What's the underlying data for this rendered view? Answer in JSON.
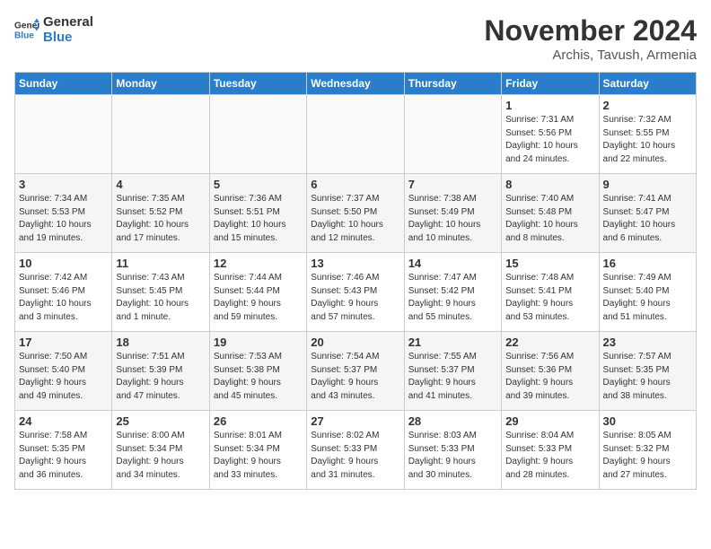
{
  "logo": {
    "line1": "General",
    "line2": "Blue"
  },
  "title": "November 2024",
  "location": "Archis, Tavush, Armenia",
  "weekdays": [
    "Sunday",
    "Monday",
    "Tuesday",
    "Wednesday",
    "Thursday",
    "Friday",
    "Saturday"
  ],
  "weeks": [
    [
      {
        "day": "",
        "info": ""
      },
      {
        "day": "",
        "info": ""
      },
      {
        "day": "",
        "info": ""
      },
      {
        "day": "",
        "info": ""
      },
      {
        "day": "",
        "info": ""
      },
      {
        "day": "1",
        "info": "Sunrise: 7:31 AM\nSunset: 5:56 PM\nDaylight: 10 hours\nand 24 minutes."
      },
      {
        "day": "2",
        "info": "Sunrise: 7:32 AM\nSunset: 5:55 PM\nDaylight: 10 hours\nand 22 minutes."
      }
    ],
    [
      {
        "day": "3",
        "info": "Sunrise: 7:34 AM\nSunset: 5:53 PM\nDaylight: 10 hours\nand 19 minutes."
      },
      {
        "day": "4",
        "info": "Sunrise: 7:35 AM\nSunset: 5:52 PM\nDaylight: 10 hours\nand 17 minutes."
      },
      {
        "day": "5",
        "info": "Sunrise: 7:36 AM\nSunset: 5:51 PM\nDaylight: 10 hours\nand 15 minutes."
      },
      {
        "day": "6",
        "info": "Sunrise: 7:37 AM\nSunset: 5:50 PM\nDaylight: 10 hours\nand 12 minutes."
      },
      {
        "day": "7",
        "info": "Sunrise: 7:38 AM\nSunset: 5:49 PM\nDaylight: 10 hours\nand 10 minutes."
      },
      {
        "day": "8",
        "info": "Sunrise: 7:40 AM\nSunset: 5:48 PM\nDaylight: 10 hours\nand 8 minutes."
      },
      {
        "day": "9",
        "info": "Sunrise: 7:41 AM\nSunset: 5:47 PM\nDaylight: 10 hours\nand 6 minutes."
      }
    ],
    [
      {
        "day": "10",
        "info": "Sunrise: 7:42 AM\nSunset: 5:46 PM\nDaylight: 10 hours\nand 3 minutes."
      },
      {
        "day": "11",
        "info": "Sunrise: 7:43 AM\nSunset: 5:45 PM\nDaylight: 10 hours\nand 1 minute."
      },
      {
        "day": "12",
        "info": "Sunrise: 7:44 AM\nSunset: 5:44 PM\nDaylight: 9 hours\nand 59 minutes."
      },
      {
        "day": "13",
        "info": "Sunrise: 7:46 AM\nSunset: 5:43 PM\nDaylight: 9 hours\nand 57 minutes."
      },
      {
        "day": "14",
        "info": "Sunrise: 7:47 AM\nSunset: 5:42 PM\nDaylight: 9 hours\nand 55 minutes."
      },
      {
        "day": "15",
        "info": "Sunrise: 7:48 AM\nSunset: 5:41 PM\nDaylight: 9 hours\nand 53 minutes."
      },
      {
        "day": "16",
        "info": "Sunrise: 7:49 AM\nSunset: 5:40 PM\nDaylight: 9 hours\nand 51 minutes."
      }
    ],
    [
      {
        "day": "17",
        "info": "Sunrise: 7:50 AM\nSunset: 5:40 PM\nDaylight: 9 hours\nand 49 minutes."
      },
      {
        "day": "18",
        "info": "Sunrise: 7:51 AM\nSunset: 5:39 PM\nDaylight: 9 hours\nand 47 minutes."
      },
      {
        "day": "19",
        "info": "Sunrise: 7:53 AM\nSunset: 5:38 PM\nDaylight: 9 hours\nand 45 minutes."
      },
      {
        "day": "20",
        "info": "Sunrise: 7:54 AM\nSunset: 5:37 PM\nDaylight: 9 hours\nand 43 minutes."
      },
      {
        "day": "21",
        "info": "Sunrise: 7:55 AM\nSunset: 5:37 PM\nDaylight: 9 hours\nand 41 minutes."
      },
      {
        "day": "22",
        "info": "Sunrise: 7:56 AM\nSunset: 5:36 PM\nDaylight: 9 hours\nand 39 minutes."
      },
      {
        "day": "23",
        "info": "Sunrise: 7:57 AM\nSunset: 5:35 PM\nDaylight: 9 hours\nand 38 minutes."
      }
    ],
    [
      {
        "day": "24",
        "info": "Sunrise: 7:58 AM\nSunset: 5:35 PM\nDaylight: 9 hours\nand 36 minutes."
      },
      {
        "day": "25",
        "info": "Sunrise: 8:00 AM\nSunset: 5:34 PM\nDaylight: 9 hours\nand 34 minutes."
      },
      {
        "day": "26",
        "info": "Sunrise: 8:01 AM\nSunset: 5:34 PM\nDaylight: 9 hours\nand 33 minutes."
      },
      {
        "day": "27",
        "info": "Sunrise: 8:02 AM\nSunset: 5:33 PM\nDaylight: 9 hours\nand 31 minutes."
      },
      {
        "day": "28",
        "info": "Sunrise: 8:03 AM\nSunset: 5:33 PM\nDaylight: 9 hours\nand 30 minutes."
      },
      {
        "day": "29",
        "info": "Sunrise: 8:04 AM\nSunset: 5:33 PM\nDaylight: 9 hours\nand 28 minutes."
      },
      {
        "day": "30",
        "info": "Sunrise: 8:05 AM\nSunset: 5:32 PM\nDaylight: 9 hours\nand 27 minutes."
      }
    ]
  ]
}
